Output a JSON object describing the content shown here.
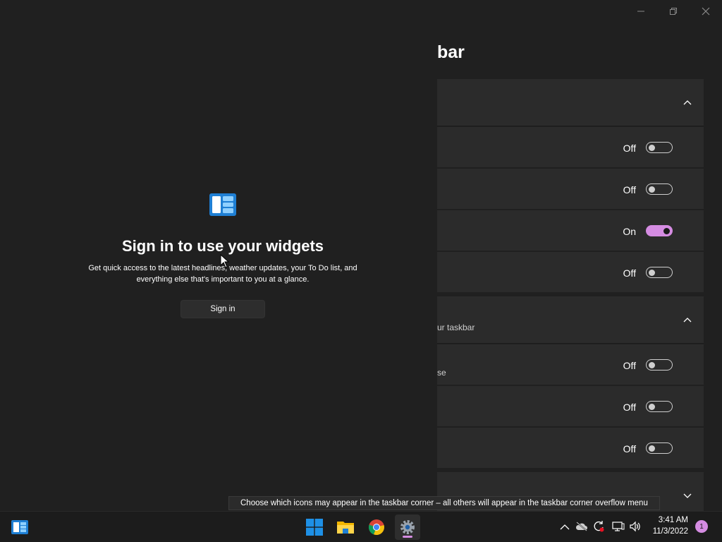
{
  "settings": {
    "page_title": "bar",
    "sections": [
      {
        "label": "",
        "expanded": true,
        "rows": [
          {
            "label": "",
            "state": "Off",
            "on": false
          },
          {
            "label": "",
            "state": "Off",
            "on": false
          },
          {
            "label": "",
            "state": "On",
            "on": true
          },
          {
            "label": "",
            "state": "Off",
            "on": false
          }
        ]
      },
      {
        "label": "ur taskbar",
        "expanded": true,
        "rows": [
          {
            "label": "se",
            "state": "Off",
            "on": false
          },
          {
            "label": "",
            "state": "Off",
            "on": false
          },
          {
            "label": "",
            "state": "Off",
            "on": false
          }
        ]
      },
      {
        "label": "",
        "expanded": false,
        "rows": []
      }
    ]
  },
  "widgets": {
    "title": "Sign in to use your widgets",
    "description": "Get quick access to the latest headlines, weather updates, your To Do list, and everything else that's important to you at a glance.",
    "sign_in_label": "Sign in"
  },
  "tooltip": "Choose which icons may appear in the taskbar corner – all others will appear in the taskbar corner overflow menu",
  "taskbar": {
    "clock_time": "3:41 AM",
    "clock_date": "11/3/2022",
    "notification_count": "1",
    "apps": [
      "start",
      "file-explorer",
      "chrome",
      "settings"
    ],
    "colors": {
      "accent": "#d58ce2",
      "windows_blue": "#1e90e6"
    }
  }
}
